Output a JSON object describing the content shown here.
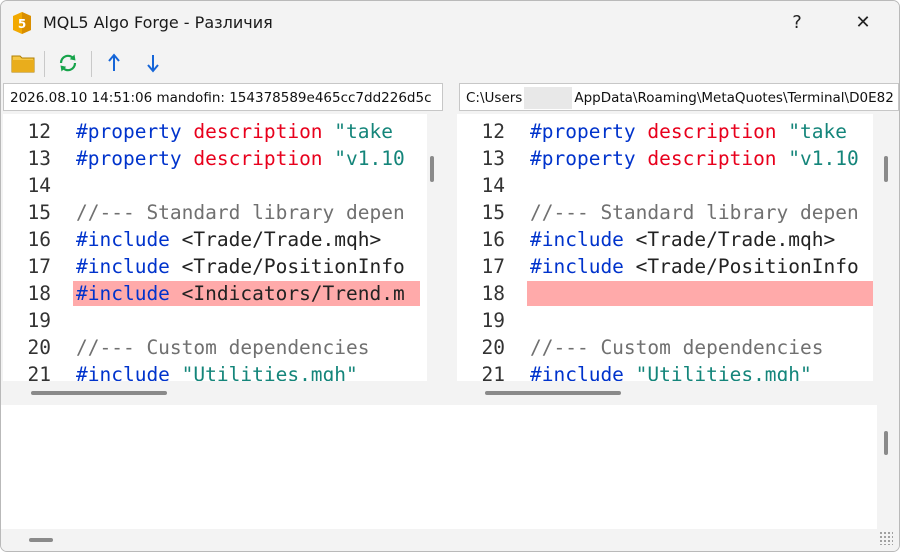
{
  "window": {
    "title": "MQL5 Algo Forge - Различия",
    "help_label": "?",
    "close_label": "✕"
  },
  "toolbar": {
    "items": [
      {
        "name": "open-folder-icon",
        "color": "#e0a800"
      },
      {
        "name": "refresh-icon",
        "color": "#16a34a"
      },
      {
        "name": "prev-diff-icon",
        "label": "↑",
        "color": "#1565d8"
      },
      {
        "name": "next-diff-icon",
        "label": "↓",
        "color": "#1565d8"
      }
    ]
  },
  "left": {
    "path": "2026.08.10 14:51:06 mandofin: 154378589e465cc7dd226d5c",
    "lines": [
      {
        "num": "12",
        "tokens": [
          {
            "t": "#property ",
            "c": "kw"
          },
          {
            "t": "description ",
            "c": "rd"
          },
          {
            "t": "\"take",
            "c": "gr"
          }
        ]
      },
      {
        "num": "13",
        "tokens": [
          {
            "t": "#property ",
            "c": "kw"
          },
          {
            "t": "description ",
            "c": "rd"
          },
          {
            "t": "\"v1.10",
            "c": "gr"
          }
        ]
      },
      {
        "num": "14",
        "tokens": []
      },
      {
        "num": "15",
        "tokens": [
          {
            "t": "//--- Standard library depen",
            "c": "cm"
          }
        ]
      },
      {
        "num": "16",
        "tokens": [
          {
            "t": "#include ",
            "c": "kw"
          },
          {
            "t": "<Trade/Trade.mqh>",
            "c": "tx"
          }
        ]
      },
      {
        "num": "17",
        "tokens": [
          {
            "t": "#include ",
            "c": "kw"
          },
          {
            "t": "<Trade/PositionInfo",
            "c": "tx"
          }
        ]
      },
      {
        "num": "18",
        "tokens": [
          {
            "t": "#include ",
            "c": "kw"
          },
          {
            "t": "<Indicators/Trend.m",
            "c": "tx"
          }
        ],
        "highlight": true
      },
      {
        "num": "19",
        "tokens": []
      },
      {
        "num": "20",
        "tokens": [
          {
            "t": "//--- Custom dependencies",
            "c": "cm"
          }
        ]
      },
      {
        "num": "21",
        "tokens": [
          {
            "t": "#include ",
            "c": "kw"
          },
          {
            "t": "\"Utilities.mqh\"",
            "c": "gr"
          }
        ]
      }
    ]
  },
  "right": {
    "path_prefix": "C:\\Users",
    "path_suffix": "AppData\\Roaming\\MetaQuotes\\Terminal\\D0E82",
    "lines": [
      {
        "num": "12",
        "tokens": [
          {
            "t": "#property ",
            "c": "kw"
          },
          {
            "t": "description ",
            "c": "rd"
          },
          {
            "t": "\"take",
            "c": "gr"
          }
        ]
      },
      {
        "num": "13",
        "tokens": [
          {
            "t": "#property ",
            "c": "kw"
          },
          {
            "t": "description ",
            "c": "rd"
          },
          {
            "t": "\"v1.10",
            "c": "gr"
          }
        ]
      },
      {
        "num": "14",
        "tokens": []
      },
      {
        "num": "15",
        "tokens": [
          {
            "t": "//--- Standard library depen",
            "c": "cm"
          }
        ]
      },
      {
        "num": "16",
        "tokens": [
          {
            "t": "#include ",
            "c": "kw"
          },
          {
            "t": "<Trade/Trade.mqh>",
            "c": "tx"
          }
        ]
      },
      {
        "num": "17",
        "tokens": [
          {
            "t": "#include ",
            "c": "kw"
          },
          {
            "t": "<Trade/PositionInfo",
            "c": "tx"
          }
        ]
      },
      {
        "num": "18",
        "tokens": [],
        "highlight": true
      },
      {
        "num": "19",
        "tokens": []
      },
      {
        "num": "20",
        "tokens": [
          {
            "t": "//--- Custom dependencies",
            "c": "cm"
          }
        ]
      },
      {
        "num": "21",
        "tokens": [
          {
            "t": "#include ",
            "c": "kw"
          },
          {
            "t": "\"Utilities.mqh\"",
            "c": "gr"
          }
        ]
      }
    ]
  },
  "colors": {
    "diff_highlight": "#ffaaaa",
    "keyword": "#0033cc",
    "property_name": "#e8001c",
    "string": "#14857a",
    "comment": "#707070"
  }
}
